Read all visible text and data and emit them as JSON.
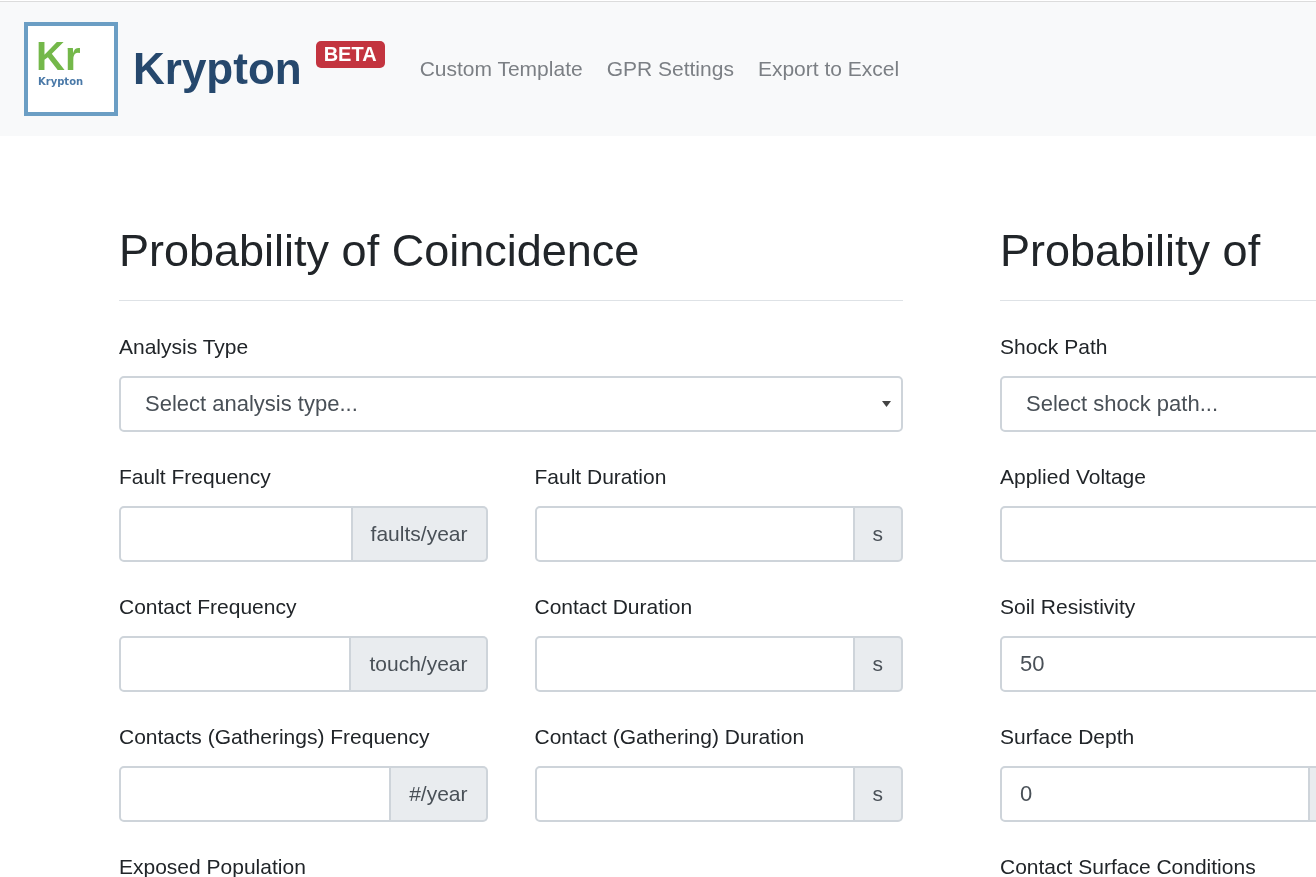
{
  "navbar": {
    "logo": {
      "symbol": "Kr",
      "caption": "Krypton"
    },
    "brand": "Krypton",
    "badge": "BETA",
    "links": [
      "Custom Template",
      "GPR Settings",
      "Export to Excel"
    ]
  },
  "sections": [
    {
      "title": "Probability of Coincidence",
      "rows": [
        [
          {
            "kind": "select",
            "label": "Analysis Type",
            "placeholder": "Select analysis type..."
          }
        ],
        [
          {
            "kind": "input",
            "label": "Fault Frequency",
            "addon": "faults/year"
          },
          {
            "kind": "input",
            "label": "Fault Duration",
            "addon": "s"
          }
        ],
        [
          {
            "kind": "input",
            "label": "Contact Frequency",
            "addon": "touch/year"
          },
          {
            "kind": "input",
            "label": "Contact Duration",
            "addon": "s"
          }
        ],
        [
          {
            "kind": "input",
            "label": "Contacts (Gatherings) Frequency",
            "addon": "#/year"
          },
          {
            "kind": "input",
            "label": "Contact (Gathering) Duration",
            "addon": "s"
          }
        ],
        [
          {
            "kind": "label",
            "label": "Exposed Population"
          }
        ]
      ]
    },
    {
      "title": "Probability of",
      "rows": [
        [
          {
            "kind": "select",
            "label": "Shock Path",
            "placeholder": "Select shock path..."
          }
        ],
        [
          {
            "kind": "input",
            "label": "Applied Voltage"
          }
        ],
        [
          {
            "kind": "input",
            "label": "Soil Resistivity",
            "value": "50"
          }
        ],
        [
          {
            "kind": "input",
            "label": "Surface Depth",
            "value": "0",
            "addon_cut": true
          }
        ],
        [
          {
            "kind": "label",
            "label": "Contact Surface Conditions"
          }
        ]
      ]
    }
  ]
}
